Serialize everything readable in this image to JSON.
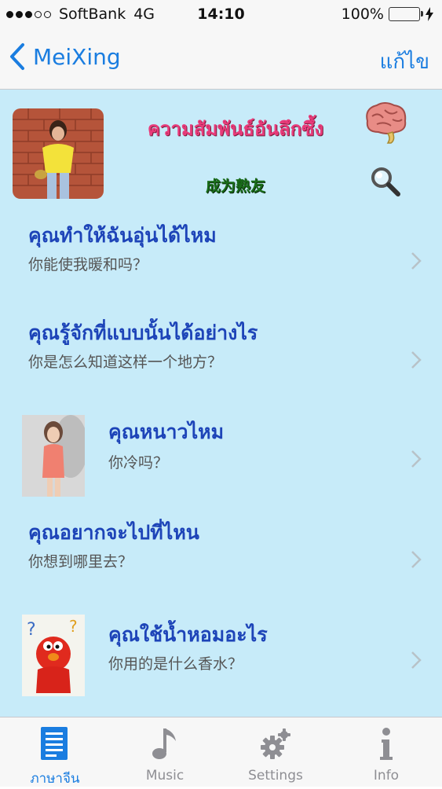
{
  "status_bar": {
    "carrier": "SoftBank",
    "network": "4G",
    "time": "14:10",
    "battery": "100%"
  },
  "nav": {
    "back_label": "MeiXing",
    "edit_label": "แก้ไข"
  },
  "header": {
    "title": "ความสัมพันธ์อันลึกซึ้ง",
    "subtitle": "成为熟友"
  },
  "phrases": [
    {
      "thai": "คุณทำให้ฉันอุ่นได้ไหม",
      "chinese": "你能使我暖和吗？"
    },
    {
      "thai": "คุณรู้จักที่แบบนั้นได้อย่างไร",
      "chinese": "你是怎么知道这样一个地方？"
    },
    {
      "thai": "คุณหนาวไหม",
      "chinese": "你冷吗？"
    },
    {
      "thai": "คุณอยากจะไปที่ไหน",
      "chinese": "你想到哪里去？"
    },
    {
      "thai": "คุณใช้น้ำหอมอะไร",
      "chinese": "你用的是什么香水？"
    }
  ],
  "tabs": [
    {
      "label": "ภาษาจีน",
      "icon": "document-list-icon",
      "active": true
    },
    {
      "label": "Music",
      "icon": "music-note-icon",
      "active": false
    },
    {
      "label": "Settings",
      "icon": "gear-icon",
      "active": false
    },
    {
      "label": "Info",
      "icon": "info-icon",
      "active": false
    }
  ],
  "colors": {
    "accent": "#1a7de0",
    "content_bg": "#c7ebf9",
    "thai_text": "#1d44b8",
    "title": "#e83b7a",
    "subtitle": "#1a6e1a"
  }
}
